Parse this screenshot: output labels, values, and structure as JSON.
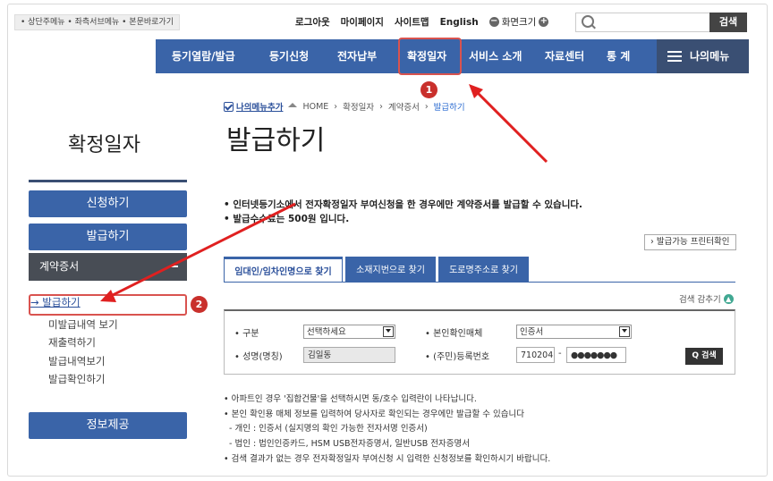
{
  "topbar": {
    "skip_links": "• 상단주메뉴 • 좌측서브메뉴 • 본문바로가기",
    "links": [
      "로그아웃",
      "마이페이지",
      "사이트맵",
      "English"
    ],
    "zoom_label": "화면크기",
    "zoom_minus": "−",
    "zoom_plus": "+",
    "search_placeholder": "",
    "search_button": "검색"
  },
  "nav": {
    "items": [
      "등기열람/발급",
      "등기신청",
      "전자납부",
      "확정일자",
      "서비스 소개",
      "자료센터",
      "통 계"
    ],
    "my_menu": "나의메뉴"
  },
  "annotations": {
    "badge1": "1",
    "badge2": "2"
  },
  "breadcrumb": {
    "favorite": "나의메뉴추가",
    "home": "HOME",
    "path": [
      "확정일자",
      "계약증서",
      "발급하기"
    ]
  },
  "page": {
    "title": "발급하기",
    "section_title": "확정일자"
  },
  "sidebar": {
    "apply": "신청하기",
    "issue": "발급하기",
    "contract": "계약증서",
    "sub_active": "→ 발급하기",
    "sub_items": [
      "미발급내역 보기",
      "재출력하기",
      "발급내역보기",
      "발급확인하기"
    ],
    "info": "정보제공"
  },
  "notices": [
    "• 인터넷등기소에서 전자확정일자 부여신청을 한 경우에만 계약증서를 발급할 수 있습니다.",
    "• 발급수수료는 500원 입니다."
  ],
  "printer_button": "› 발급가능 프린터확인",
  "tabs": [
    "임대인/임차인명으로 찾기",
    "소재지번으로 찾기",
    "도로명주소로 찾기"
  ],
  "collapse_label": "검색 감추기",
  "form": {
    "category_label": "• 구분",
    "category_value": "선택하세요",
    "id_medium_label": "• 본인확인매체",
    "id_medium_value": "인증서",
    "name_label": "• 성명(명칭)",
    "name_value": "김일동",
    "reg_label": "• (주민)등록번호",
    "reg_front": "710204",
    "reg_dash": "-",
    "reg_back": "●●●●●●●",
    "search_button": "검색"
  },
  "notes": [
    "• 아파트인 경우 '집합건물'을 선택하시면 동/호수 입력란이 나타납니다.",
    "• 본인 확인용 매체 정보를 입력하여 당사자로 확인되는 경우에만 발급할 수 있습니다",
    "- 개인 : 인증서 (실지명의 확인 가능한 전자서명 인증서)",
    "- 법인 : 법인인증카드, HSM USB전자증명서, 일반USB 전자증명서",
    "• 검색 결과가 없는 경우 전자확정일자 부여신청 시 입력한 신청정보를 확인하시기 바랍니다."
  ],
  "colors": {
    "nav_blue": "#3a64a8",
    "dark": "#484d55",
    "highlight_red": "#d9534f",
    "arrow_red": "#e02020"
  }
}
